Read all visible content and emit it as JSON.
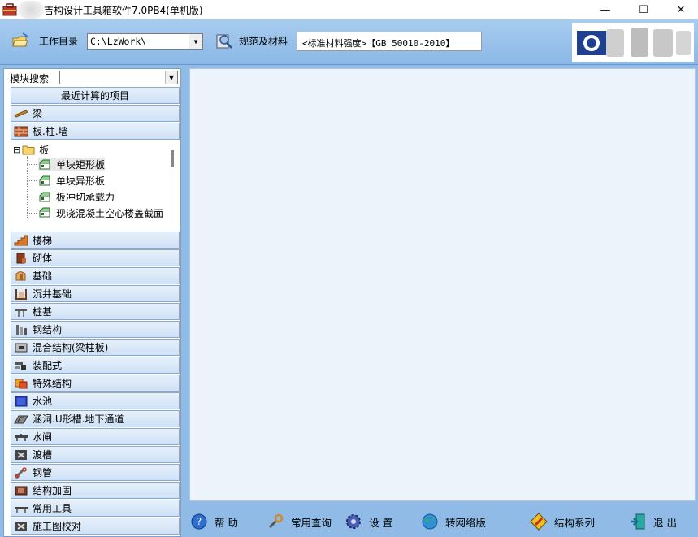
{
  "window": {
    "title": "结构设计工具箱软件7.0PB4(单机版)",
    "title_visible": "吉构设计工具箱软件7.0PB4(单机版)",
    "min_glyph": "—",
    "max_glyph": "☐",
    "close_glyph": "✕"
  },
  "toolbar": {
    "workdir_label": "工作目录",
    "workdir_value": "C:\\LzWork\\",
    "spec_label": "规范及材料",
    "spec_value": "<标准材料强度>【GB 50010-2010】"
  },
  "search": {
    "label": "模块搜索",
    "value": ""
  },
  "categories_top": [
    {
      "label": "最近计算的项目",
      "icon": "none"
    },
    {
      "label": "梁",
      "icon": "beam-icon"
    },
    {
      "label": "板.柱.墙",
      "icon": "brick-icon"
    }
  ],
  "tree": {
    "root_toggle": "⊟",
    "root_label": "板",
    "leaves": [
      {
        "label": "单块矩形板"
      },
      {
        "label": "单块异形板"
      },
      {
        "label": "板冲切承载力"
      },
      {
        "label": "现浇混凝土空心楼盖截面"
      }
    ]
  },
  "categories_bottom": [
    {
      "label": "楼梯",
      "icon": "stair-icon"
    },
    {
      "label": "砌体",
      "icon": "masonry-icon"
    },
    {
      "label": "基础",
      "icon": "foundation-icon"
    },
    {
      "label": "沉井基础",
      "icon": "caisson-icon"
    },
    {
      "label": "桩基",
      "icon": "pile-icon"
    },
    {
      "label": "钢结构",
      "icon": "steel-icon"
    },
    {
      "label": "混合结构(梁柱板)",
      "icon": "mixed-icon"
    },
    {
      "label": "装配式",
      "icon": "prefab-icon"
    },
    {
      "label": "特殊结构",
      "icon": "special-icon"
    },
    {
      "label": "水池",
      "icon": "pool-icon"
    },
    {
      "label": "涵洞.U形槽.地下通道",
      "icon": "culvert-icon"
    },
    {
      "label": "水闸",
      "icon": "sluice-icon"
    },
    {
      "label": "渡槽",
      "icon": "aqueduct-icon"
    },
    {
      "label": "钢管",
      "icon": "pipe-icon"
    },
    {
      "label": "结构加固",
      "icon": "reinforce-icon"
    },
    {
      "label": "常用工具",
      "icon": "tools-icon"
    },
    {
      "label": "施工图校对",
      "icon": "check-icon"
    }
  ],
  "bottombar": {
    "help": "帮 助",
    "query": "常用查询",
    "settings": "设 置",
    "network": "转网络版",
    "series": "结构系列",
    "exit": "退 出"
  }
}
